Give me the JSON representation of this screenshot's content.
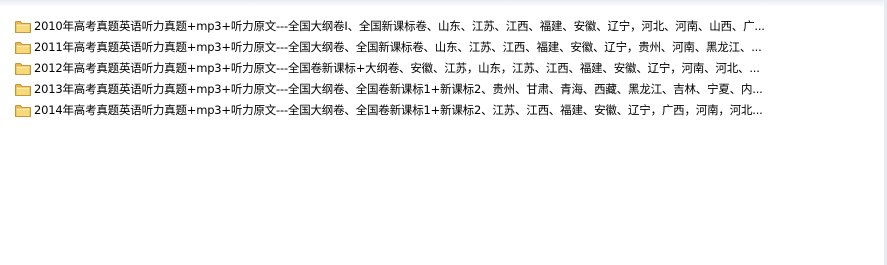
{
  "files": [
    {
      "name": "2010年高考真题英语听力真题+mp3+听力原文---全国大纲卷I、全国新课标卷、山东、江苏、江西、福建、安徽、辽宁，河北、河南、山西、广...",
      "icon": "folder-icon"
    },
    {
      "name": "2011年高考真题英语听力真题+mp3+听力原文---全国大纲卷、全国新课标卷、山东、江苏、江西、福建、安徽、辽宁，贵州、河南、黑龙江、...",
      "icon": "folder-icon"
    },
    {
      "name": "2012年高考真题英语听力真题+mp3+听力原文---全国卷新课标+大纲卷、安徽、江苏，山东，江苏、江西、福建、安徽、辽宁，河南、河北、...",
      "icon": "folder-icon"
    },
    {
      "name": "2013年高考真题英语听力真题+mp3+听力原文---全国大纲卷、全国卷新课标1+新课标2、贵州、甘肃、青海、西藏、黑龙江、吉林、宁夏、内...",
      "icon": "folder-icon"
    },
    {
      "name": "2014年高考真题英语听力真题+mp3+听力原文---全国大纲卷、全国卷新课标1+新课标2、江苏、江西、福建、安徽、辽宁，广西，河南，河北...",
      "icon": "folder-icon"
    }
  ]
}
